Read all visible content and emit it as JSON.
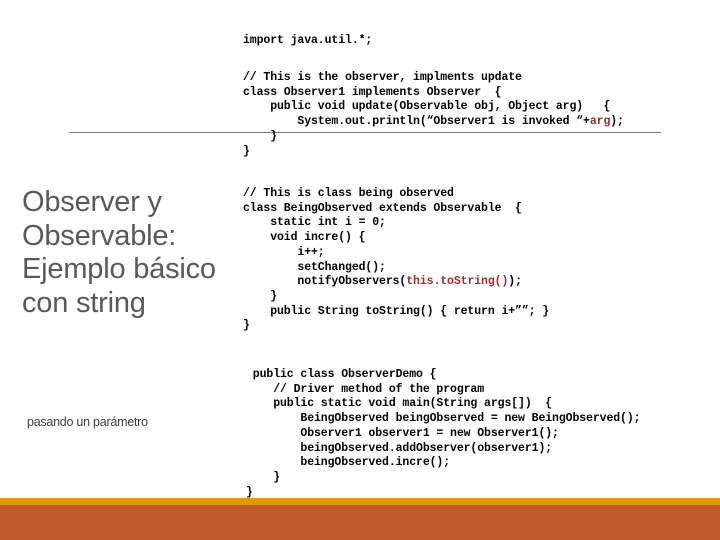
{
  "slide": {
    "title": "Observer y Observable: Ejemplo básico con string",
    "subtitle": "pasando un parámetro",
    "accent_stripe_color": "#e8930c",
    "accent_band_color": "#c05a2b",
    "title_color": "#595959",
    "rule_color": "#7f7f7f",
    "highlight_color": "#9e2a2b"
  },
  "code": {
    "import_block": "import java.util.*;",
    "observer_block_pre": "// This is the observer, implments update\nclass Observer1 implements Observer  {\n    public void update(Observable obj, Object arg)   {\n        System.out.println(“Observer1 is invoked “+",
    "observer_block_highlight": "arg",
    "observer_block_post": ");\n    }\n}",
    "observed_block_pre": "// This is class being observed\nclass BeingObserved extends Observable  {\n    static int i = 0;\n    void incre() {\n        i++;\n        setChanged();\n        notifyObservers(",
    "observed_block_highlight": "this.toString()",
    "observed_block_post": ");\n    }\n    public String toString() { return i+””; }\n}",
    "demo_block": " public class ObserverDemo {\n    // Driver method of the program\n    public static void main(String args[])  {\n        BeingObserved beingObserved = new BeingObserved();\n        Observer1 observer1 = new Observer1();\n        beingObserved.addObserver(observer1);\n        beingObserved.incre();\n    }\n}"
  }
}
